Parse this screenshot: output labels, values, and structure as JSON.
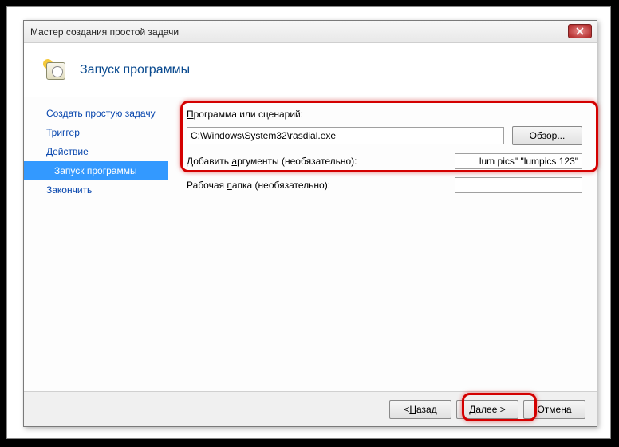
{
  "window": {
    "title": "Мастер создания простой задачи"
  },
  "header": {
    "title": "Запуск программы"
  },
  "sidebar": {
    "items": [
      {
        "label": "Создать простую задачу"
      },
      {
        "label": "Триггер"
      },
      {
        "label": "Действие"
      },
      {
        "label": "Запуск программы"
      },
      {
        "label": "Закончить"
      }
    ]
  },
  "form": {
    "program_label_first": "П",
    "program_label_rest": "рограмма или сценарий:",
    "program_value": "C:\\Windows\\System32\\rasdial.exe",
    "browse_label": "Обзор...",
    "args_label_pre": "Добавить ",
    "args_label_first": "а",
    "args_label_rest": "ргументы (необязательно):",
    "args_value": "lum pics\" \"lumpics 123\"",
    "workdir_label_pre": "Рабочая ",
    "workdir_label_first": "п",
    "workdir_label_rest": "апка (необязательно):",
    "workdir_value": ""
  },
  "footer": {
    "back_prefix": "< ",
    "back_first": "Н",
    "back_rest": "азад",
    "next_first": "Д",
    "next_rest": "алее >",
    "cancel_label": "Отмена"
  }
}
